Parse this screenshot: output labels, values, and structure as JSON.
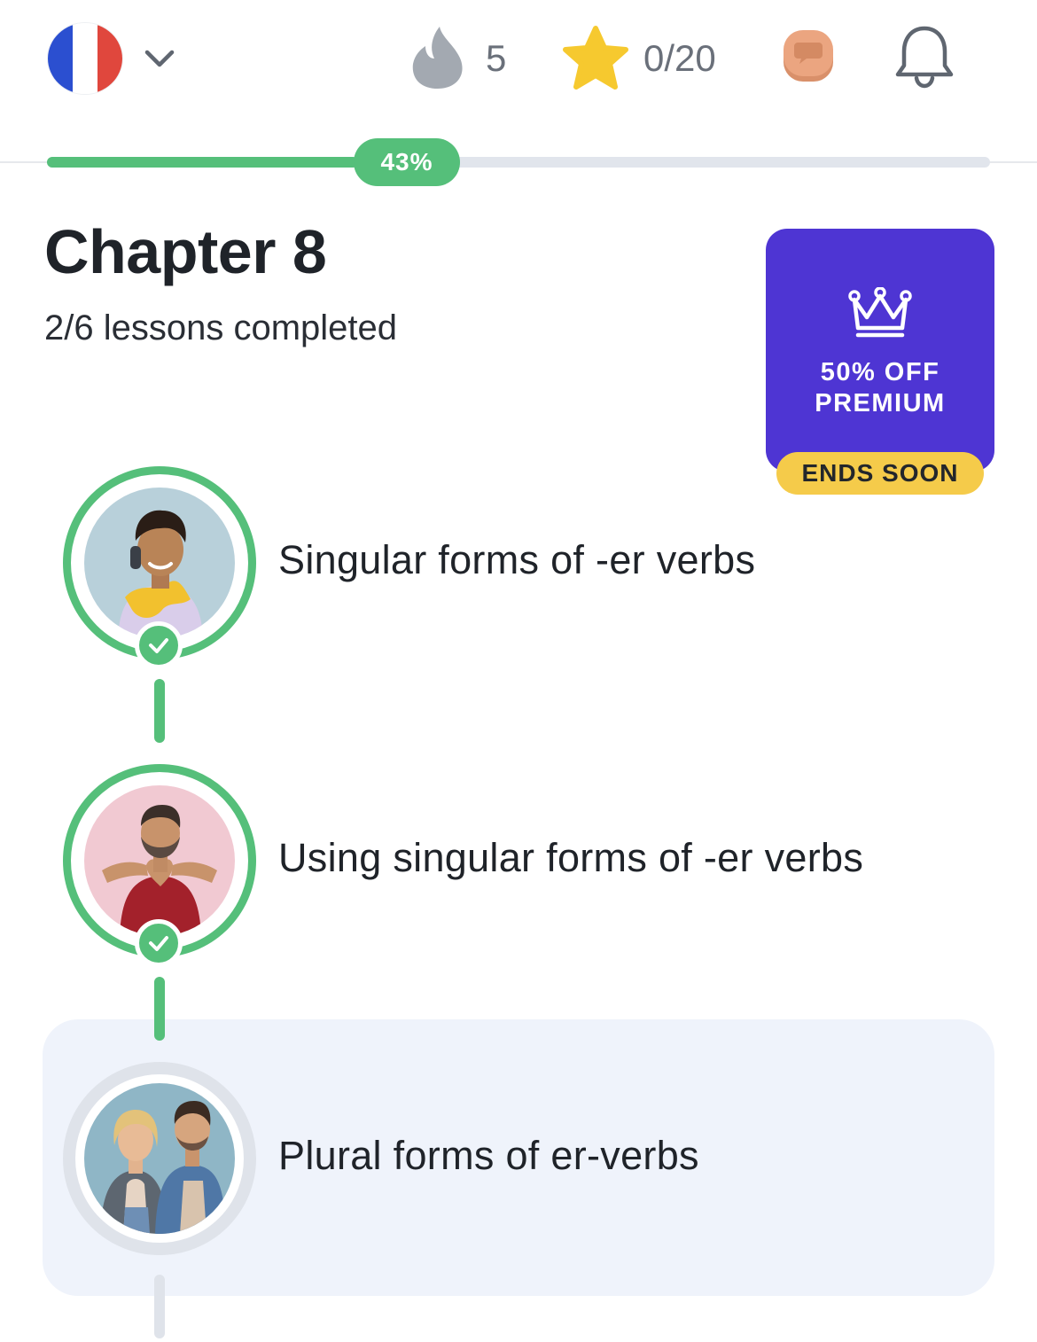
{
  "header": {
    "language": "French",
    "language_flag_colors": [
      "#2b4fd0",
      "#ffffff",
      "#e0473d"
    ],
    "language_menu_icon": "chevron-down-icon",
    "streak_icon": "flame-icon",
    "streak_count": "5",
    "xp_icon": "star-icon",
    "xp_progress": "0/20",
    "chat_icon": "speech-bubble-icon",
    "notifications_icon": "bell-icon"
  },
  "progress": {
    "percent_label": "43%",
    "percent_value": 0.33
  },
  "chapter": {
    "title": "Chapter 8",
    "subtitle": "2/6 lessons completed"
  },
  "premium": {
    "icon": "crown-icon",
    "line1": "50% OFF",
    "line2": "PREMIUM",
    "badge": "ENDS SOON"
  },
  "lessons": [
    {
      "title": "Singular forms of -er verbs",
      "status": "completed"
    },
    {
      "title": "Using singular forms of -er verbs",
      "status": "completed"
    },
    {
      "title": "Plural forms of er-verbs",
      "status": "current"
    }
  ],
  "colors": {
    "accent_green": "#55bf7a",
    "premium_purple": "#4e35d3",
    "badge_yellow": "#f5cb4a",
    "current_lesson_bg": "#eff3fb",
    "track_gray": "#e1e5ec"
  }
}
